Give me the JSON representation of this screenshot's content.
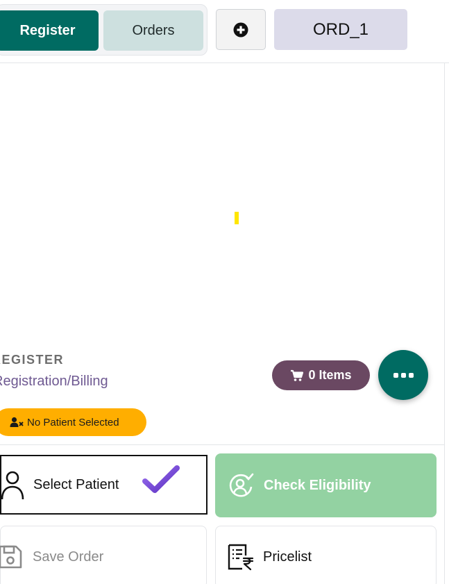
{
  "header": {
    "tabs": [
      {
        "label": "Register",
        "active": true
      },
      {
        "label": "Orders",
        "active": false
      }
    ],
    "add_icon": "plus-circle-icon",
    "order_chip_label": "ORD_1"
  },
  "section": {
    "heading": "REGISTER",
    "subheading": "Registration/Billing"
  },
  "cart": {
    "icon": "cart-icon",
    "label": "0 Items"
  },
  "more_icon": "more-dots-icon",
  "status": {
    "icon": "user-x-icon",
    "label": "No Patient Selected"
  },
  "actions": [
    {
      "label": "Select Patient",
      "icon": "user-icon"
    },
    {
      "label": "Check Eligibility",
      "icon": "user-check-circle-icon"
    },
    {
      "label": "Save Order",
      "icon": "save-icon"
    },
    {
      "label": "Pricelist",
      "icon": "pricelist-rupee-icon"
    }
  ],
  "colors": {
    "primary": "#006b62",
    "tab_inactive": "#cde0df",
    "cart": "#6a4862",
    "badge": "#ffae00",
    "eligibility": "#93d2a2",
    "subheading": "#6f5a92",
    "checkmark": "#7b4fd6"
  }
}
